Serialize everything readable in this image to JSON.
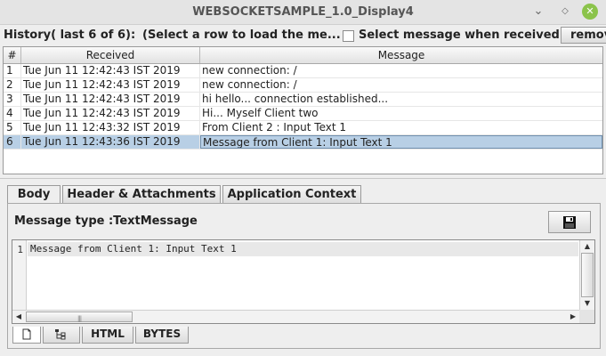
{
  "window": {
    "title": "WEBSOCKETSAMPLE_1.0_Display4",
    "minimize_glyph": "⌄",
    "maximize_glyph": "◇",
    "close_glyph": "✕"
  },
  "toolbar": {
    "history_label": "History( last 6 of 6):",
    "select_hint": "(Select a row to load the me...",
    "checkbox_label": "Select message when received",
    "checkbox_checked": false,
    "remove_label": "remov"
  },
  "table": {
    "headers": [
      "#",
      "Received",
      "Message"
    ],
    "selected_row": 6,
    "rows": [
      {
        "num": "1",
        "received": "Tue Jun 11 12:42:43 IST 2019",
        "message": "new connection: /"
      },
      {
        "num": "2",
        "received": "Tue Jun 11 12:42:43 IST 2019",
        "message": "new connection: /"
      },
      {
        "num": "3",
        "received": "Tue Jun 11 12:42:43 IST 2019",
        "message": "hi hello... connection established..."
      },
      {
        "num": "4",
        "received": "Tue Jun 11 12:42:43 IST 2019",
        "message": "Hi... Myself Client two"
      },
      {
        "num": "5",
        "received": "Tue Jun 11 12:43:32 IST 2019",
        "message": "From Client 2 : Input Text 1"
      },
      {
        "num": "6",
        "received": "Tue Jun 11 12:43:36 IST 2019",
        "message": "Message from Client 1: Input Text 1"
      }
    ]
  },
  "tabs": {
    "items": [
      "Body",
      "Header & Attachments",
      "Application Context"
    ],
    "active": "Body"
  },
  "body_panel": {
    "message_type": "Message type :TextMessage",
    "save_icon": "save-icon",
    "editor": {
      "line_number": "1",
      "content": "Message from Client 1: Input Text 1"
    }
  },
  "bottom_tabs": {
    "items": [
      "text-view-icon",
      "tree-view-icon",
      "HTML",
      "BYTES"
    ],
    "html_label": "HTML",
    "bytes_label": "BYTES",
    "active": "text-view-icon"
  },
  "colors": {
    "selected_row": "#b8cfe5",
    "close_button": "#8bc34a",
    "save_icon": "#111111"
  }
}
